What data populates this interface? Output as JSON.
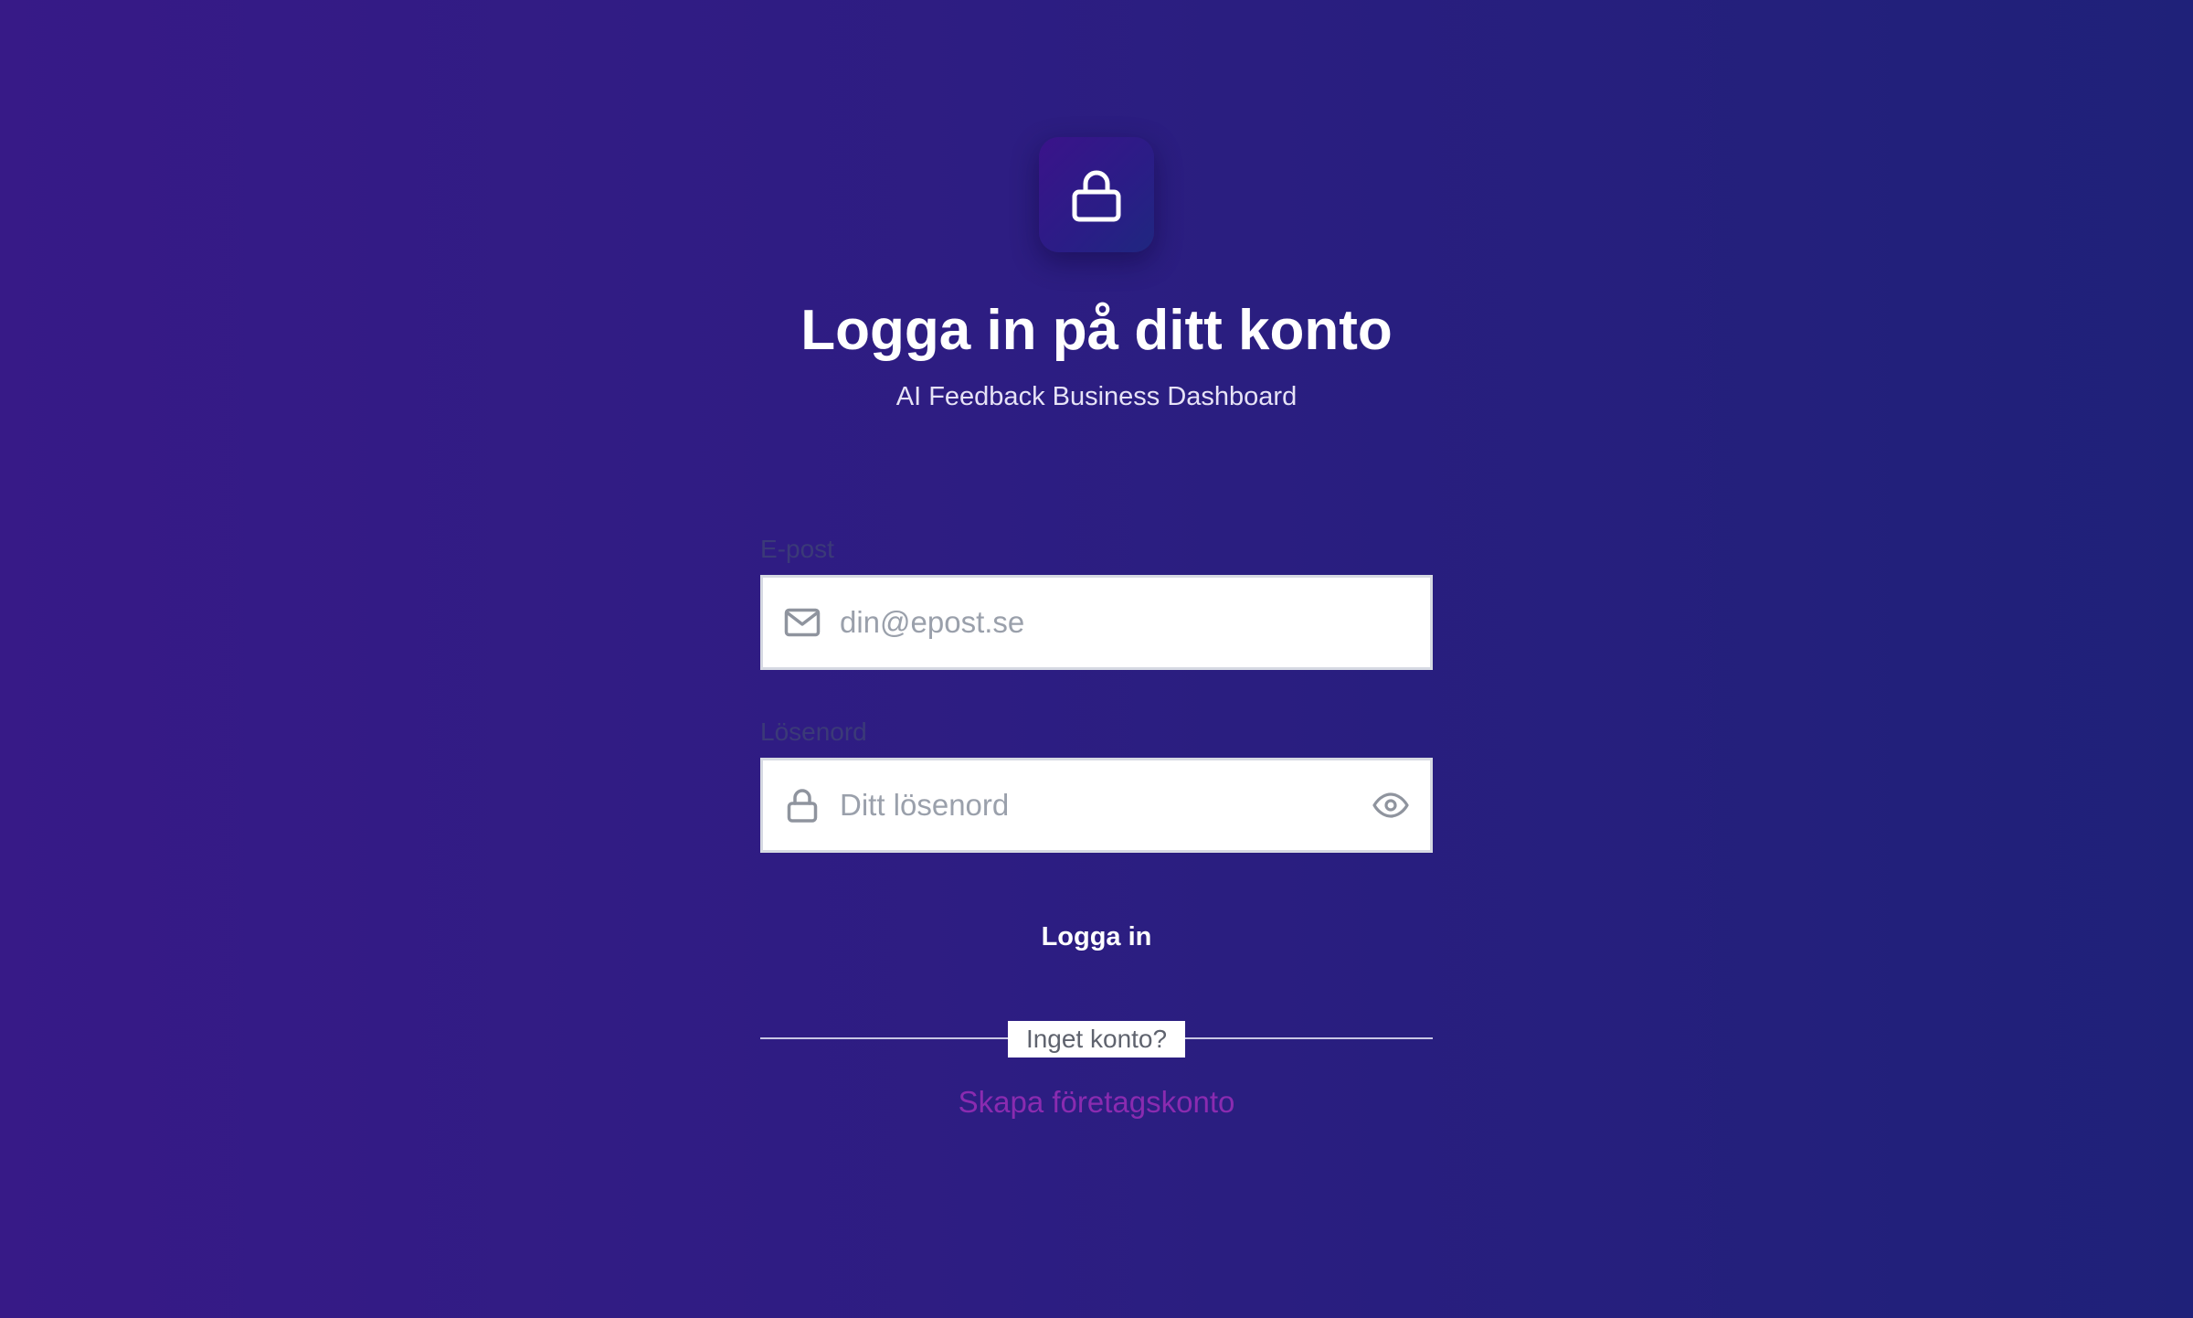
{
  "header": {
    "title": "Logga in på ditt konto",
    "subtitle": "AI Feedback Business Dashboard",
    "logo_icon": "lock-icon"
  },
  "form": {
    "email": {
      "label": "E-post",
      "placeholder": "din@epost.se",
      "value": "",
      "icon": "mail-icon"
    },
    "password": {
      "label": "Lösenord",
      "placeholder": "Ditt lösenord",
      "value": "",
      "icon": "lock-icon",
      "toggle_icon": "eye-icon"
    },
    "submit_label": "Logga in"
  },
  "register": {
    "divider_text": "Inget konto?",
    "link_label": "Skapa företagskonto"
  },
  "colors": {
    "background_start": "#371a87",
    "background_end": "#1f2179",
    "link": "#8a2bb0",
    "label": "#3b3a78"
  }
}
